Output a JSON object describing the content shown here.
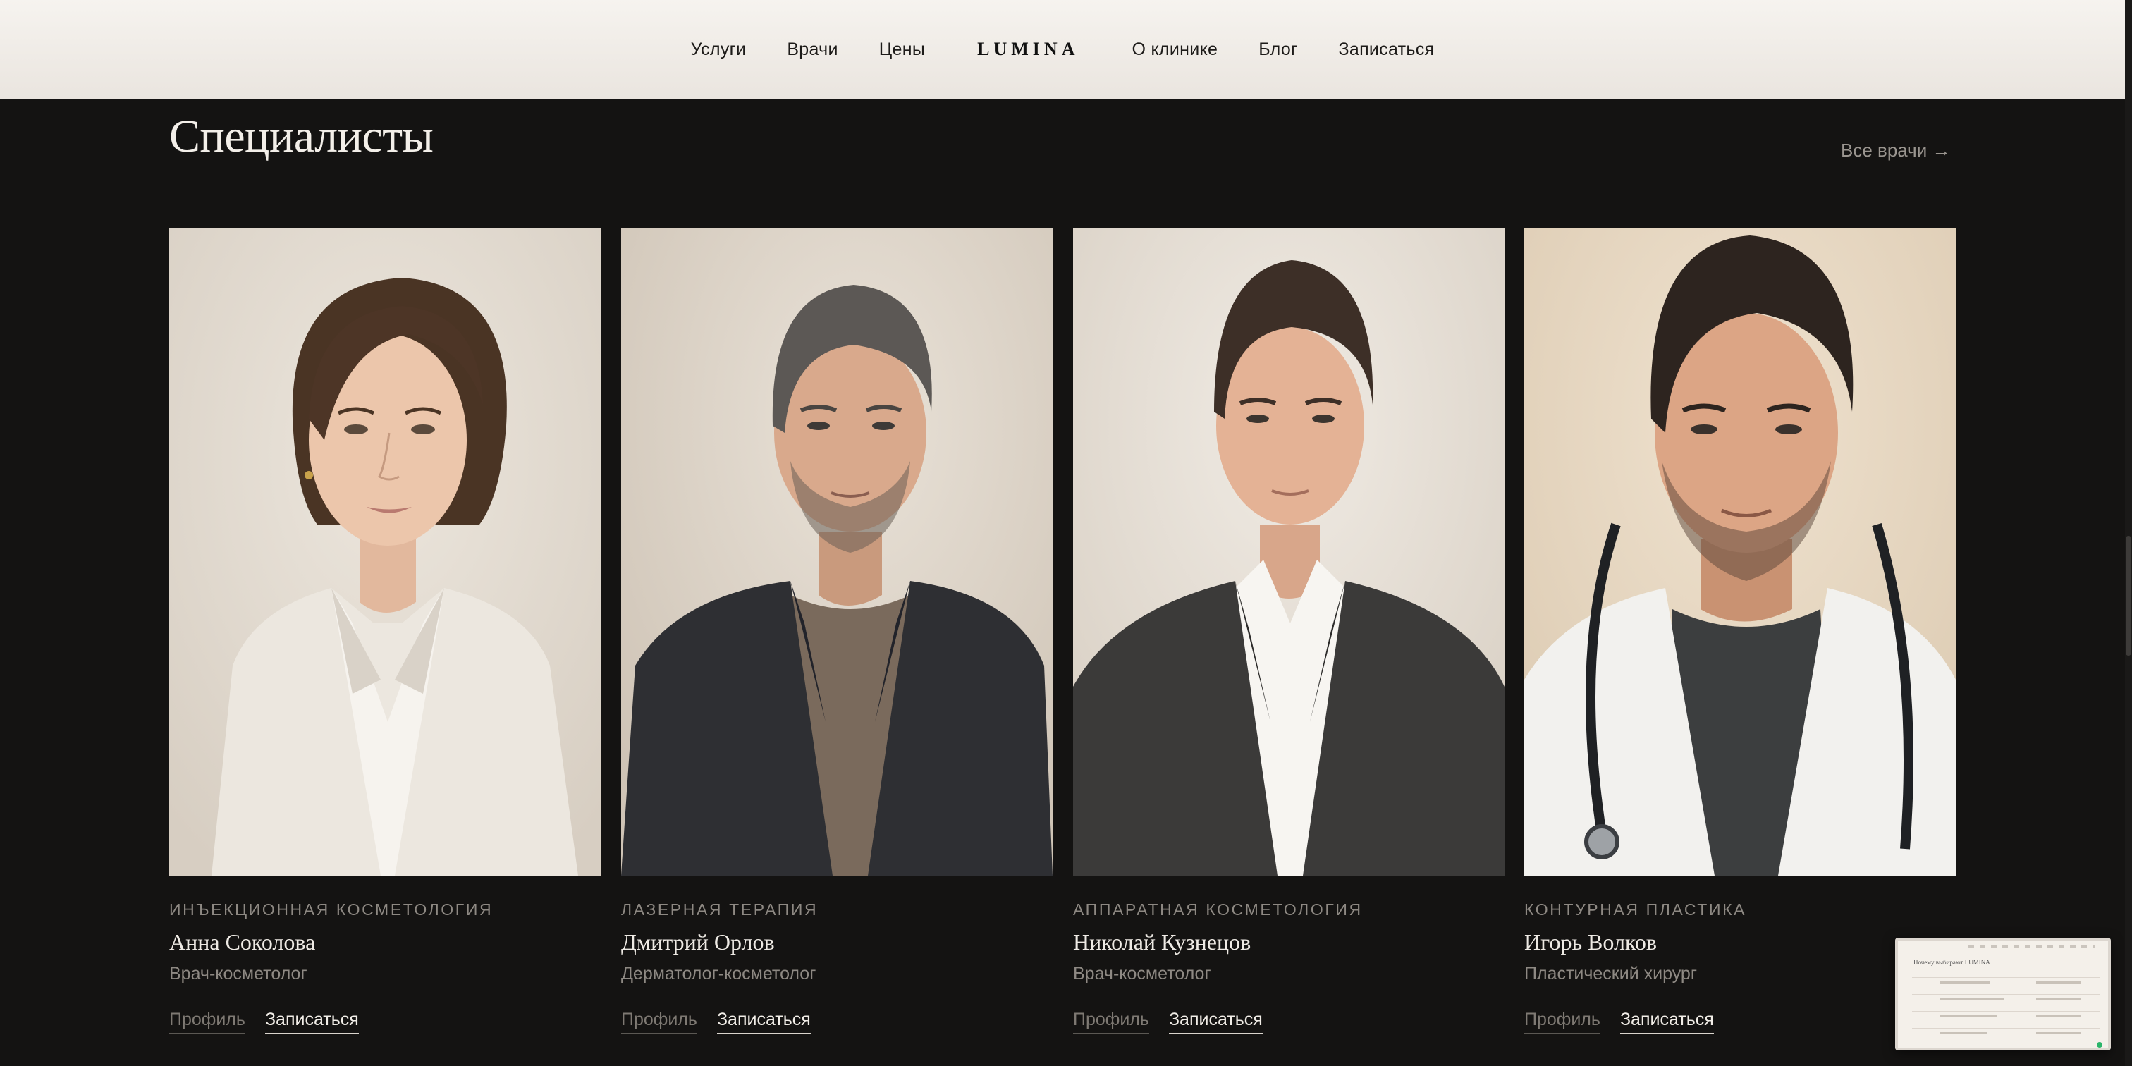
{
  "header": {
    "nav_left": [
      "Услуги",
      "Врачи",
      "Цены"
    ],
    "logo": "LUMINA",
    "nav_right": [
      "О клинике",
      "Блог",
      "Записаться"
    ]
  },
  "section": {
    "title": "Специалисты",
    "all_link": "Все врачи →"
  },
  "doctors": [
    {
      "specialty": "Инъекционная косметология",
      "name": "Анна Соколова",
      "role": "Врач-косметолог",
      "profile": "Профиль",
      "book": "Записаться"
    },
    {
      "specialty": "Лазерная терапия",
      "name": "Дмитрий Орлов",
      "role": "Дерматолог-косметолог",
      "profile": "Профиль",
      "book": "Записаться"
    },
    {
      "specialty": "Аппаратная косметология",
      "name": "Николай Кузнецов",
      "role": "Врач-косметолог",
      "profile": "Профиль",
      "book": "Записаться"
    },
    {
      "specialty": "Контурная пластика",
      "name": "Игорь Волков",
      "role": "Пластический хирург",
      "profile": "Профиль",
      "book": "Записаться"
    }
  ],
  "thumbnail": {
    "title": "Почему выбирают LUMINA"
  },
  "colors": {
    "page_bg": "#141312",
    "header_bg": "#f1ede8",
    "text_light": "#eeeae4",
    "text_muted": "#8e8983"
  },
  "icons": [
    "arrow-right-icon",
    "portrait-woman",
    "portrait-man-jacket",
    "portrait-man-shirt",
    "portrait-man-stethoscope"
  ]
}
